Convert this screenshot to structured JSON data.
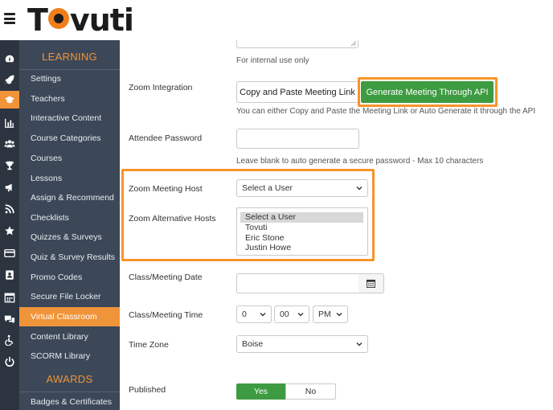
{
  "brand": {
    "logo_pre": "T",
    "logo_post": "vuti"
  },
  "sidebar": {
    "learning_heading": "LEARNING",
    "awards_heading": "AWARDS",
    "items": [
      {
        "label": "Settings"
      },
      {
        "label": "Teachers"
      },
      {
        "label": "Interactive Content"
      },
      {
        "label": "Course Categories"
      },
      {
        "label": "Courses"
      },
      {
        "label": "Lessons"
      },
      {
        "label": "Assign & Recommend"
      },
      {
        "label": "Checklists"
      },
      {
        "label": "Quizzes & Surveys"
      },
      {
        "label": "Quiz & Survey Results"
      },
      {
        "label": "Promo Codes"
      },
      {
        "label": "Secure File Locker"
      },
      {
        "label": "Virtual Classroom"
      },
      {
        "label": "Content Library"
      },
      {
        "label": "SCORM Library"
      }
    ],
    "awards_items": [
      {
        "label": "Badges & Certificates"
      }
    ],
    "active_item": "Virtual Classroom",
    "icons": [
      "dashboard-icon",
      "rocket-icon",
      "graduation-cap-icon",
      "bar-chart-icon",
      "users-icon",
      "trophy-icon",
      "megaphone-icon",
      "rss-icon",
      "star-icon",
      "credit-card-icon",
      "id-badge-icon",
      "calendar-icon",
      "chat-icon",
      "accessibility-icon",
      "power-icon"
    ]
  },
  "form": {
    "internal_note": "For internal use only",
    "zoom_integration": {
      "label": "Zoom Integration",
      "copy_button": "Copy and Paste Meeting Link",
      "generate_button": "Generate Meeting Through API",
      "help": "You can either Copy and Paste the Meeting Link or Auto Generate it through the API"
    },
    "attendee_password": {
      "label": "Attendee Password",
      "value": "",
      "help": "Leave blank to auto generate a secure password - Max 10 characters"
    },
    "meeting_host": {
      "label": "Zoom Meeting Host",
      "selected": "Select a User"
    },
    "alternative_hosts": {
      "label": "Zoom Alternative Hosts",
      "options": [
        "Select a User",
        "Tovuti",
        "Eric Stone",
        "Justin Howe"
      ]
    },
    "meeting_date": {
      "label": "Class/Meeting Date",
      "value": ""
    },
    "meeting_time": {
      "label": "Class/Meeting Time",
      "hour": "0",
      "minute": "00",
      "ampm": "PM"
    },
    "time_zone": {
      "label": "Time Zone",
      "selected": "Boise"
    },
    "published": {
      "label": "Published",
      "yes": "Yes",
      "no": "No",
      "value": "Yes"
    }
  },
  "colors": {
    "accent": "#f0943a",
    "sidebar_bg": "#3c4858",
    "rail_bg": "#2c3440",
    "success": "#3d9b42",
    "highlight": "#f5952a"
  }
}
